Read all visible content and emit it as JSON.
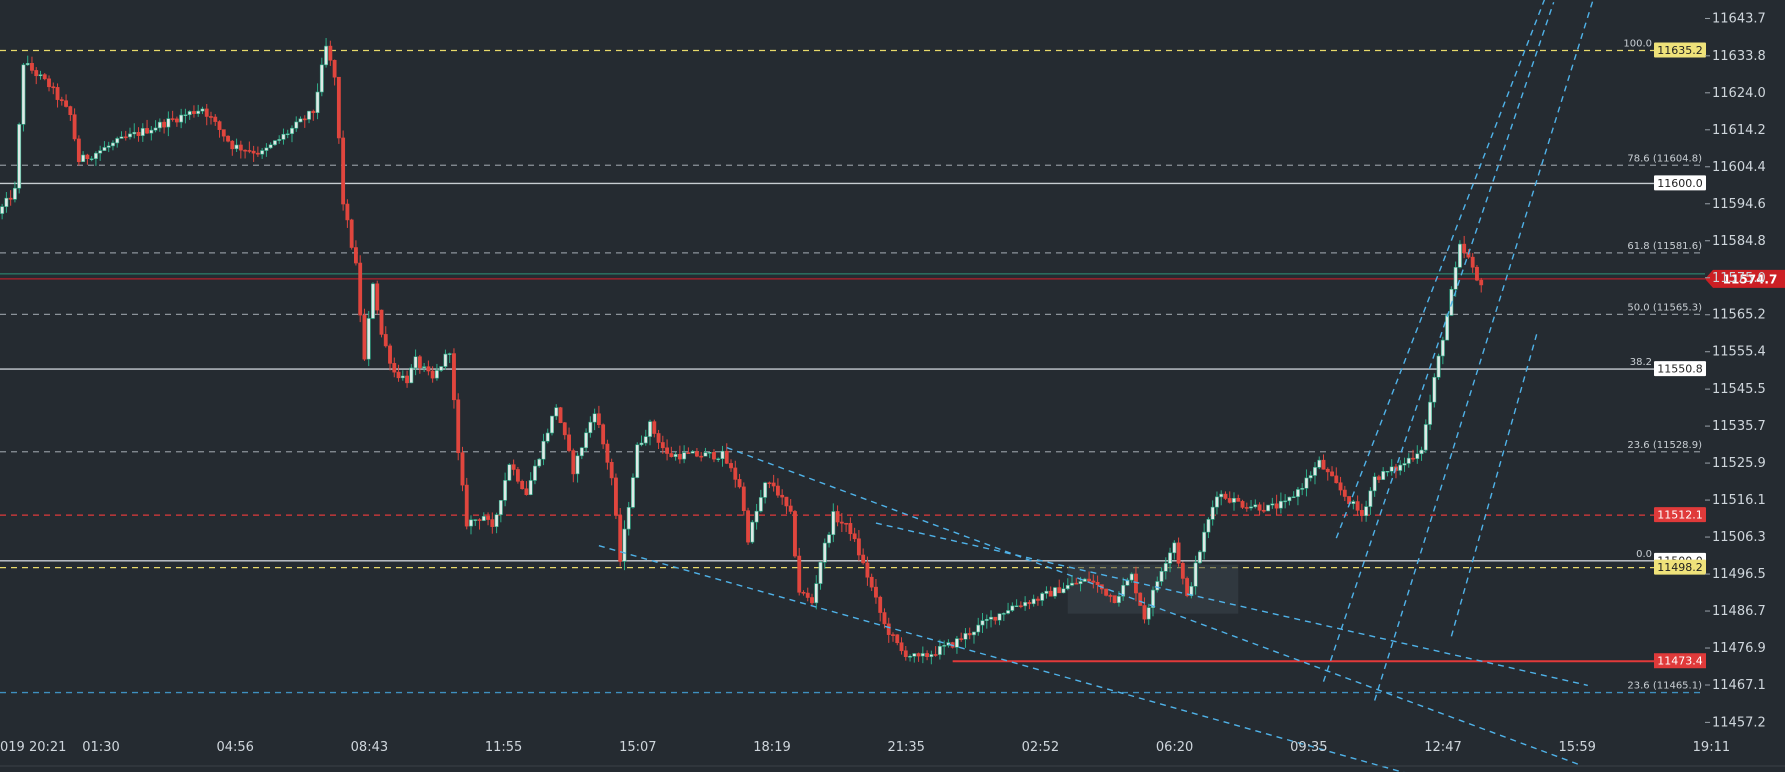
{
  "chart_data": {
    "type": "candlestick",
    "title": "",
    "xlabel": "",
    "ylabel": "",
    "ylim": [
      11452.0,
      11647.0
    ],
    "y_ticks": [
      "11643.7",
      "11633.8",
      "11624.0",
      "11614.2",
      "11604.4",
      "11594.6",
      "11584.8",
      "11575.0",
      "11565.2",
      "11555.4",
      "11545.5",
      "11535.7",
      "11525.9",
      "11516.1",
      "11506.3",
      "11496.5",
      "11486.7",
      "11476.9",
      "11467.1",
      "11457.2"
    ],
    "x_ticks": [
      "019 20:21",
      "01:30",
      "04:56",
      "08:43",
      "11:55",
      "15:07",
      "18:19",
      "21:35",
      "02:52",
      "06:20",
      "09:35",
      "12:47",
      "15:59",
      "19:11"
    ],
    "last_price": {
      "value": 11574.7,
      "label": "11574.7",
      "color": "#cc1f24"
    },
    "horizontal_levels": [
      {
        "price": 11635.2,
        "style": "dashed",
        "color": "#e8d96a",
        "tag": "11635.2",
        "tag_bg": "#efe27a",
        "tag_fg": "#222222",
        "label": "100.0"
      },
      {
        "price": 11604.8,
        "style": "dashed",
        "color": "#8c939a",
        "label": "78.6 (11604.8)"
      },
      {
        "price": 11600.0,
        "style": "solid",
        "color": "#c8cdd2",
        "tag": "11600.0",
        "tag_bg": "#ffffff",
        "tag_fg": "#222222"
      },
      {
        "price": 11581.6,
        "style": "dashed",
        "color": "#8c939a",
        "label": "61.8 (11581.6)"
      },
      {
        "price": 11565.3,
        "style": "dashed",
        "color": "#8c939a",
        "label": "50.0 (11565.3)"
      },
      {
        "price": 11550.8,
        "style": "solid",
        "color": "#c8cdd2",
        "tag": "11550.8",
        "tag_bg": "#ffffff",
        "tag_fg": "#222222",
        "label": "38.2"
      },
      {
        "price": 11528.9,
        "style": "dashed",
        "color": "#8c939a",
        "label": "23.6 (11528.9)"
      },
      {
        "price": 11512.1,
        "style": "dashed",
        "color": "#e03a3a",
        "tag": "11512.1",
        "tag_bg": "#e03a3a",
        "tag_fg": "#ffffff"
      },
      {
        "price": 11500.0,
        "style": "solid",
        "color": "#c8cdd2",
        "tag": "11500.0",
        "tag_bg": "#ffffff",
        "tag_fg": "#222222",
        "label": "0.0"
      },
      {
        "price": 11498.2,
        "style": "dashed",
        "color": "#e8d96a",
        "tag": "11498.2",
        "tag_bg": "#efe27a",
        "tag_fg": "#222222"
      },
      {
        "price": 11465.1,
        "style": "dashed",
        "color": "#3e8fbf",
        "label": "23.6 (11465.1)",
        "label_color": "#3e8fbf"
      }
    ],
    "support_line": {
      "price": 11473.4,
      "start_index": 223,
      "color": "#e23a3a",
      "tag": "11473.4",
      "tag_bg": "#e03a3a",
      "tag_fg": "#ffffff"
    },
    "channel_color": "#4fb2e8",
    "down_channel": [
      [
        [
          170,
          11530.0
        ],
        [
          370,
          11446.0
        ]
      ],
      [
        [
          140,
          11504.0
        ],
        [
          360,
          11434.0
        ]
      ],
      [
        [
          205,
          11510.0
        ],
        [
          372,
          11467.0
        ]
      ]
    ],
    "up_channel": [
      [
        [
          313,
          11506.0
        ],
        [
          364,
          11655.0
        ]
      ],
      [
        [
          322,
          11463.0
        ],
        [
          375,
          11655.0
        ]
      ],
      [
        [
          310,
          11468.0
        ],
        [
          364,
          11648.0
        ]
      ],
      [
        [
          340,
          11480.0
        ],
        [
          360,
          11560.0
        ]
      ]
    ],
    "range_box": {
      "x0": 250,
      "x1": 290,
      "y0": 11499.0,
      "y1": 11486.0
    },
    "bull_color": "#2fae8a",
    "bear_color": "#e0463e",
    "anchors": [
      [
        0,
        11592
      ],
      [
        4,
        11598
      ],
      [
        6,
        11632
      ],
      [
        12,
        11626
      ],
      [
        17,
        11618
      ],
      [
        19,
        11606
      ],
      [
        30,
        11612
      ],
      [
        48,
        11620
      ],
      [
        55,
        11610
      ],
      [
        62,
        11608
      ],
      [
        74,
        11619
      ],
      [
        77,
        11636
      ],
      [
        79,
        11628
      ],
      [
        81,
        11595
      ],
      [
        84,
        11578
      ],
      [
        86,
        11553
      ],
      [
        88,
        11574
      ],
      [
        90,
        11560
      ],
      [
        93,
        11550
      ],
      [
        96,
        11548
      ],
      [
        98,
        11553
      ],
      [
        102,
        11548
      ],
      [
        106,
        11556
      ],
      [
        108,
        11528
      ],
      [
        110,
        11510
      ],
      [
        114,
        11512
      ],
      [
        116,
        11508
      ],
      [
        120,
        11526
      ],
      [
        124,
        11518
      ],
      [
        127,
        11528
      ],
      [
        131,
        11541
      ],
      [
        135,
        11524
      ],
      [
        140,
        11540
      ],
      [
        144,
        11522
      ],
      [
        146,
        11500
      ],
      [
        150,
        11530
      ],
      [
        153,
        11536
      ],
      [
        157,
        11528
      ],
      [
        162,
        11528
      ],
      [
        170,
        11528
      ],
      [
        174,
        11520
      ],
      [
        176,
        11506
      ],
      [
        180,
        11520
      ],
      [
        182,
        11520
      ],
      [
        186,
        11512
      ],
      [
        188,
        11492
      ],
      [
        191,
        11489
      ],
      [
        193,
        11500
      ],
      [
        196,
        11512
      ],
      [
        200,
        11508
      ],
      [
        204,
        11496
      ],
      [
        208,
        11483
      ],
      [
        212,
        11476
      ],
      [
        216,
        11474
      ],
      [
        220,
        11476
      ],
      [
        224,
        11478
      ],
      [
        232,
        11484
      ],
      [
        238,
        11488
      ],
      [
        244,
        11490
      ],
      [
        250,
        11493
      ],
      [
        256,
        11495
      ],
      [
        262,
        11490
      ],
      [
        266,
        11496
      ],
      [
        269,
        11485
      ],
      [
        273,
        11498
      ],
      [
        276,
        11505
      ],
      [
        279,
        11490
      ],
      [
        283,
        11507
      ],
      [
        286,
        11518
      ],
      [
        292,
        11515
      ],
      [
        298,
        11514
      ],
      [
        302,
        11515
      ],
      [
        306,
        11520
      ],
      [
        310,
        11526
      ],
      [
        314,
        11520
      ],
      [
        320,
        11512
      ],
      [
        323,
        11522
      ],
      [
        329,
        11525
      ],
      [
        334,
        11530
      ],
      [
        337,
        11548
      ],
      [
        340,
        11565
      ],
      [
        343,
        11583
      ],
      [
        345,
        11580
      ],
      [
        347,
        11574
      ]
    ]
  }
}
